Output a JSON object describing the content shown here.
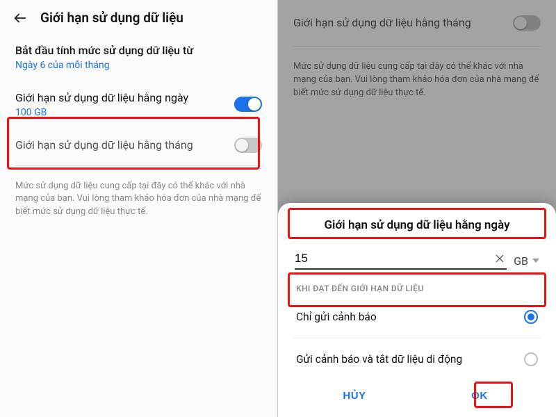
{
  "left": {
    "header_title": "Giới hạn sử dụng dữ liệu",
    "start_label": "Bắt đầu tính mức sử dụng dữ liệu từ",
    "start_value": "Ngày 6 của mỗi tháng",
    "daily": {
      "title": "Giới hạn sử dụng dữ liệu hằng ngày",
      "value": "100 GB",
      "on": true
    },
    "monthly": {
      "title": "Giới hạn sử dụng dữ liệu hằng tháng",
      "on": false
    },
    "disclaimer": "Mức sử dụng dữ liệu cung cấp tại đây có thể khác với nhà mạng của bạn. Vui lòng tham khảo hóa đơn của nhà mạng để biết mức sử dụng dữ liệu thực tế."
  },
  "right": {
    "dimmed_monthly_title": "Giới hạn sử dụng dữ liệu hằng tháng",
    "dimmed_disclaimer": "Mức sử dụng dữ liệu cung cấp tại đây có thể khác với nhà mạng của bạn. Vui lòng tham khảo hóa đơn của nhà mạng để biết mức sử dụng dữ liệu thực tế.",
    "sheet": {
      "title": "Giới hạn sử dụng dữ liệu hằng ngày",
      "input_value": "15",
      "unit": "GB",
      "caption": "KHI ĐẠT ĐẾN GIỚI HẠN DỮ LIỆU",
      "opt1": "Chỉ gửi cảnh báo",
      "opt2": "Gửi cảnh báo và tắt dữ liệu di động",
      "cancel": "HỦY",
      "ok": "OK"
    }
  }
}
